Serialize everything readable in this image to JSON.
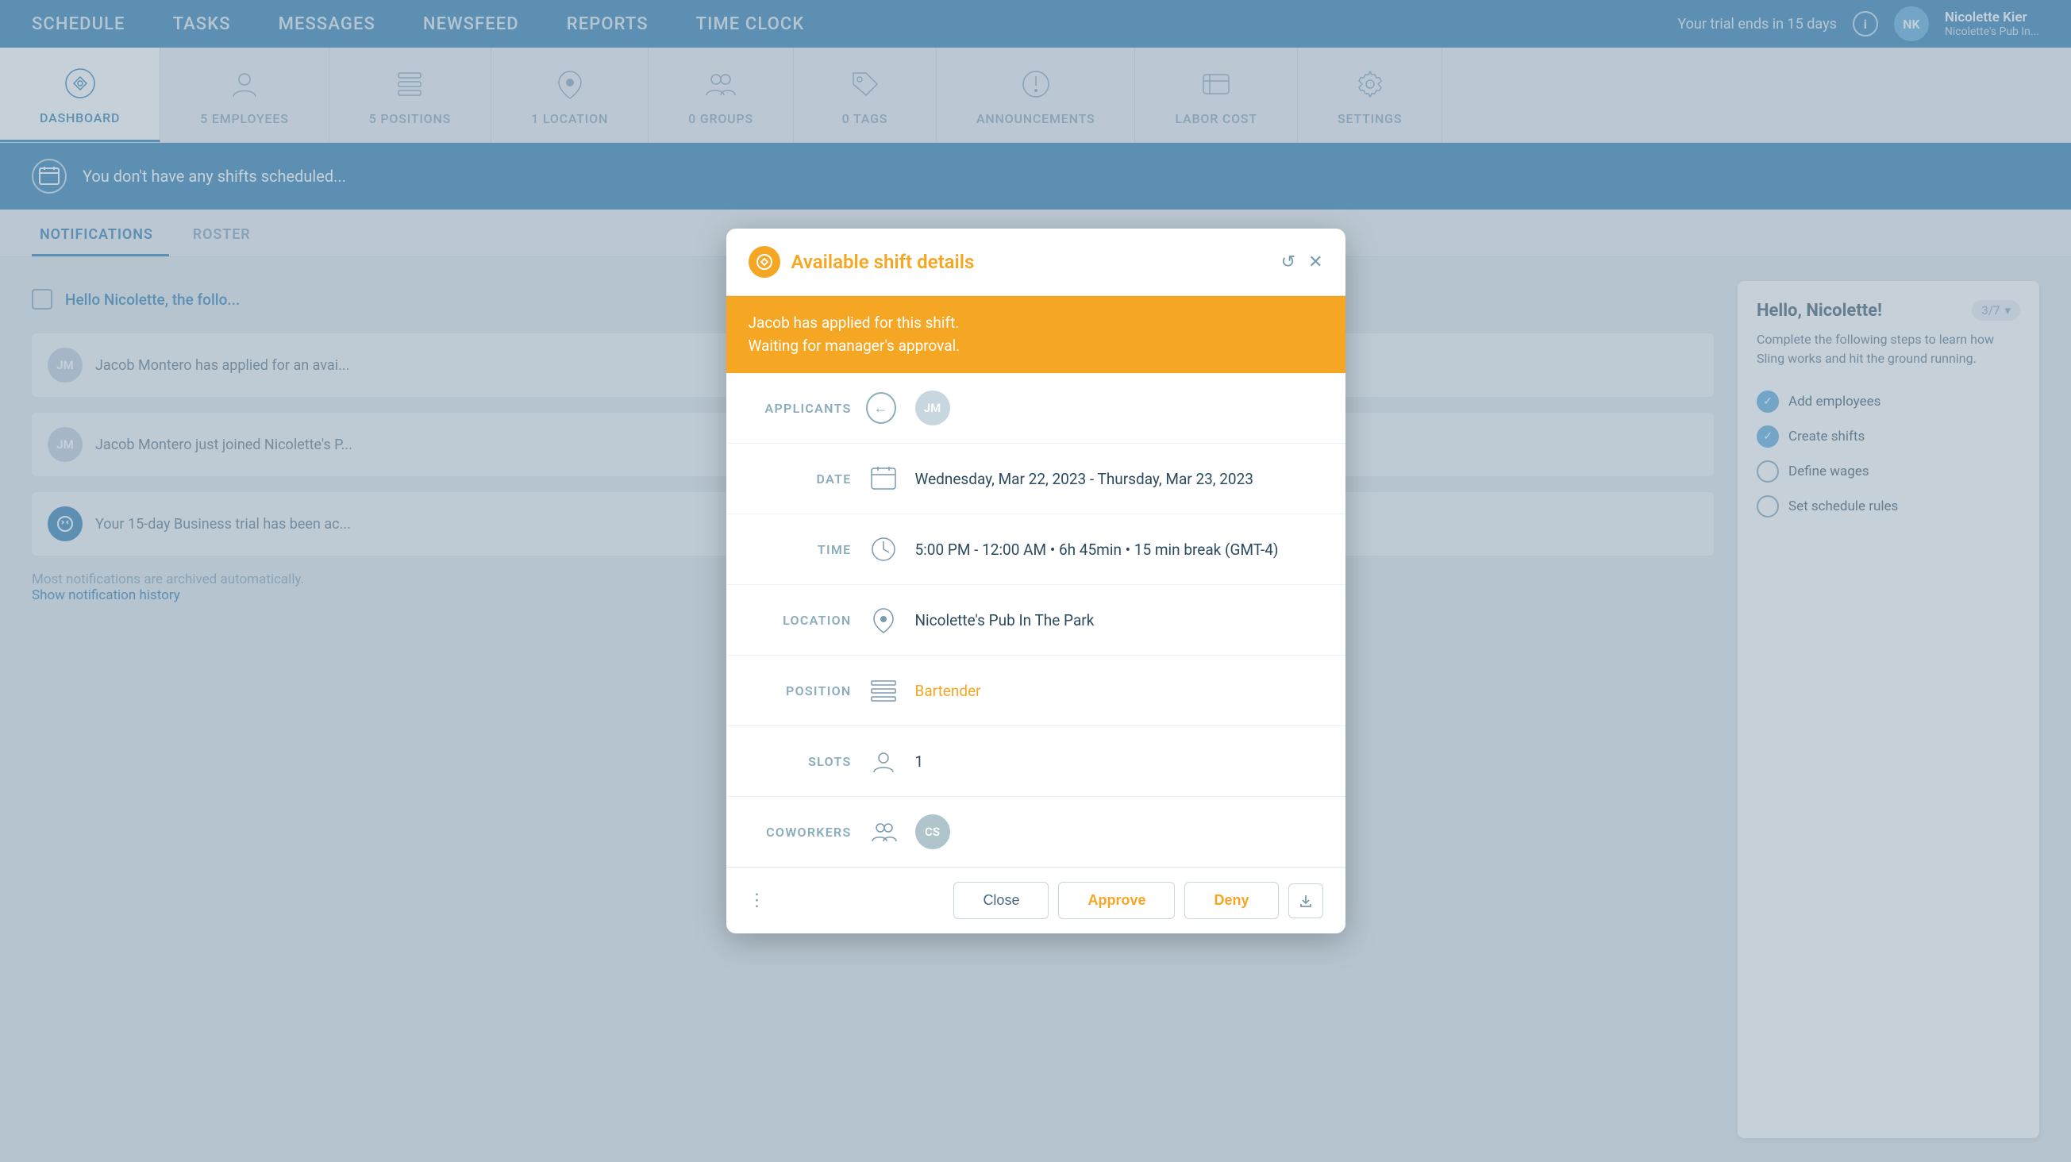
{
  "nav": {
    "items": [
      {
        "label": "SCHEDULE",
        "active": false
      },
      {
        "label": "TASKS",
        "active": false
      },
      {
        "label": "MESSAGES",
        "active": false
      },
      {
        "label": "NEWSFEED",
        "active": false
      },
      {
        "label": "REPORTS",
        "active": false
      },
      {
        "label": "TIME CLOCK",
        "active": false
      }
    ],
    "trial_text": "Your trial ends in 15 days",
    "user_initials": "NK",
    "user_name": "Nicolette Kier",
    "user_org": "Nicolette's Pub In..."
  },
  "icon_nav": {
    "items": [
      {
        "label": "DASHBOARD",
        "active": true,
        "icon": "dashboard"
      },
      {
        "label": "5 EMPLOYEES",
        "active": false,
        "icon": "employees"
      },
      {
        "label": "5 POSITIONS",
        "active": false,
        "icon": "positions"
      },
      {
        "label": "1 LOCATION",
        "active": false,
        "icon": "location"
      },
      {
        "label": "0 GROUPS",
        "active": false,
        "icon": "groups"
      },
      {
        "label": "0 TAGS",
        "active": false,
        "icon": "tags"
      },
      {
        "label": "ANNOUNCEMENTS",
        "active": false,
        "icon": "announcements"
      },
      {
        "label": "LABOR COST",
        "active": false,
        "icon": "labor_cost"
      },
      {
        "label": "SETTINGS",
        "active": false,
        "icon": "settings"
      }
    ]
  },
  "banner": {
    "text": "You don't have any shifts scheduled..."
  },
  "tabs": {
    "items": [
      {
        "label": "NOTIFICATIONS",
        "active": true
      },
      {
        "label": "ROSTER",
        "active": false
      }
    ]
  },
  "notifications": {
    "hello_text": "Hello Nicolette, the follo...",
    "items": [
      {
        "initials": "JM",
        "text": "Jacob Montero has applied for an avai..."
      },
      {
        "initials": "JM",
        "text": "Jacob Montero just joined Nicolette's P..."
      },
      {
        "initials": "",
        "icon": "sling",
        "text": "Your 15-day Business trial has been ac..."
      }
    ],
    "archive_note": "Most notifications are archived automatically.",
    "show_history": "Show notification history"
  },
  "right_panel": {
    "title": "Hello, Nicolette!",
    "progress": "3/7",
    "desc": "Complete the following steps to learn how Sling works and hit the ground running.",
    "checklist": [
      {
        "label": "Add employees",
        "done": true
      },
      {
        "label": "Create shifts",
        "done": true
      },
      {
        "label": "Define wages",
        "done": false
      },
      {
        "label": "Set schedule rules",
        "done": false
      }
    ]
  },
  "modal": {
    "title": "Available shift details",
    "alert": {
      "line1": "Jacob has applied for this shift.",
      "line2": "Waiting for manager's approval."
    },
    "applicants_label": "APPLICANTS",
    "applicant_back": "←",
    "applicant_initials": "JM",
    "date_label": "DATE",
    "date_value": "Wednesday, Mar 22, 2023 - Thursday, Mar 23, 2023",
    "time_label": "TIME",
    "time_value": "5:00 PM - 12:00 AM • 6h 45min • 15 min break (GMT-4)",
    "location_label": "LOCATION",
    "location_value": "Nicolette's Pub In The Park",
    "position_label": "POSITION",
    "position_value": "Bartender",
    "slots_label": "SLOTS",
    "slots_value": "1",
    "coworkers_label": "COWORKERS",
    "coworker_initials": "CS",
    "buttons": {
      "close": "Close",
      "approve": "Approve",
      "deny": "Deny"
    }
  }
}
